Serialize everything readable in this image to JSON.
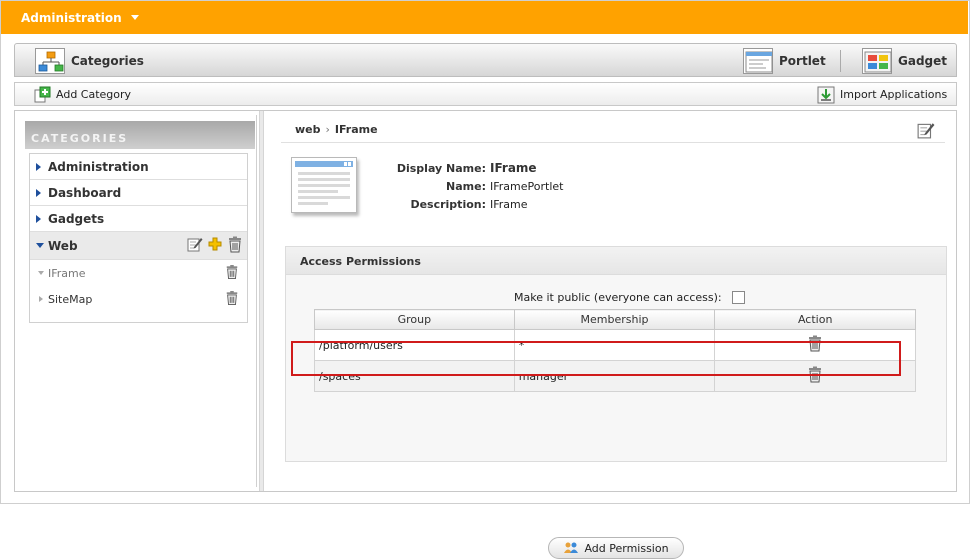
{
  "topbar": {
    "menu_label": "Administration"
  },
  "tabs": [
    {
      "label": "Categories",
      "icon": "hierarchy-icon"
    },
    {
      "label": "Portlet",
      "icon": "portlet-icon"
    },
    {
      "label": "Gadget",
      "icon": "gadget-icon"
    }
  ],
  "actions": {
    "add_category": "Add Category",
    "import_applications": "Import Applications"
  },
  "sidebar": {
    "header": "CATEGORIES",
    "categories": [
      {
        "label": "Administration",
        "expanded": false
      },
      {
        "label": "Dashboard",
        "expanded": false
      },
      {
        "label": "Gadgets",
        "expanded": false
      },
      {
        "label": "Web",
        "expanded": true
      }
    ],
    "web_children": [
      {
        "label": "IFrame",
        "selected": true
      },
      {
        "label": "SiteMap",
        "selected": false
      }
    ]
  },
  "detail": {
    "breadcrumb": [
      "web",
      "IFrame"
    ],
    "display_name_label": "Display Name:",
    "display_name": "IFrame",
    "name_label": "Name:",
    "name": "IFramePortlet",
    "description_label": "Description:",
    "description": "IFrame"
  },
  "permissions": {
    "title": "Access Permissions",
    "public_label": "Make it public (everyone can access):",
    "public_checked": false,
    "columns": [
      "Group",
      "Membership",
      "Action"
    ],
    "rows": [
      {
        "group": "/platform/users",
        "membership": "*"
      },
      {
        "group": "/spaces",
        "membership": "manager"
      }
    ],
    "add_button": "Add Permission"
  },
  "colors": {
    "topbar": "#ffa200",
    "highlight": "#d01b1b",
    "tree_arrow": "#1e4f9c"
  }
}
